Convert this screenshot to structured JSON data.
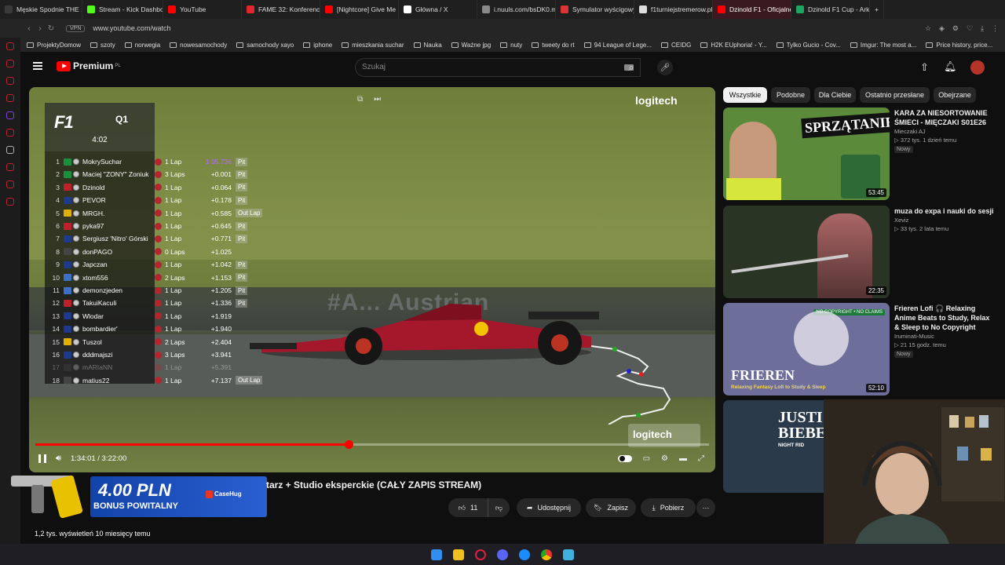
{
  "browser": {
    "tabs": [
      {
        "label": "Męskie Spodnie THE ...",
        "color": "#3a3a3a"
      },
      {
        "label": "Stream - Kick Dashbo...",
        "color": "#53fc18"
      },
      {
        "label": "YouTube",
        "color": "#ff0000"
      },
      {
        "label": "FAME 32: Konferencja...",
        "color": "#e0262b"
      },
      {
        "label": "[Nightcore] Give Me ...",
        "color": "#ff0000"
      },
      {
        "label": "Główna / X",
        "color": "#ffffff"
      },
      {
        "label": "i.nuuls.com/bsDK0.m...",
        "color": "#888888"
      },
      {
        "label": "Symulator wyścigowy ...",
        "color": "#d33"
      },
      {
        "label": "f1turniejstremerow.pl",
        "color": "#ddd"
      },
      {
        "label": "Dzinold F1 - Oficjalne ...",
        "color": "#ff0000"
      },
      {
        "label": "Dzinold F1 Cup - Arku...",
        "color": "#1fa463"
      }
    ],
    "vpn_label": "VPN",
    "url": "www.youtube.com/watch",
    "bookmarks": [
      "ProjektyDomow",
      "szoty",
      "norwegia",
      "nowesamochody",
      "samochody xayo",
      "iphone",
      "mieszkania suchar",
      "Nauka",
      "Ważne jpg",
      "nuty",
      "tweety do rt",
      "94 League of Lege...",
      "CEIDG",
      "H2K EUphoria! - Y...",
      "Tylko Gucio - Cov...",
      "Imgur: The most a...",
      "Price history, price..."
    ]
  },
  "header": {
    "logo_text": "Premium",
    "logo_region": "PL",
    "search_placeholder": "Szukaj"
  },
  "player": {
    "logitech_label": "logitech",
    "session": "Q1",
    "session_timer": "4:02",
    "time_current": "1:34:01",
    "time_total": "3:22:00",
    "time_display": "1:34:01 / 3:22:00",
    "progress_fraction": 0.465,
    "barrier_text": "#A...        Austrian",
    "leaderboard": [
      {
        "pos": "1",
        "name": "MokrySuchar",
        "laps": "1 Lap",
        "gap": "1:05.736",
        "status": "Pit",
        "team": "#1a8f3c",
        "gap_color": "#b36bff"
      },
      {
        "pos": "2",
        "name": "Maciej \"ZONY\" Zoniuk",
        "laps": "3 Laps",
        "gap": "+0.001",
        "status": "Pit",
        "team": "#1a8f3c"
      },
      {
        "pos": "3",
        "name": "Dzinold",
        "laps": "1 Lap",
        "gap": "+0.064",
        "status": "Pit",
        "team": "#c0202a"
      },
      {
        "pos": "4",
        "name": "PEVOR",
        "laps": "1 Lap",
        "gap": "+0.178",
        "status": "Pit",
        "team": "#1e3a8a"
      },
      {
        "pos": "5",
        "name": "MRGH.",
        "laps": "1 Lap",
        "gap": "+0.585",
        "status": "Out Lap",
        "team": "#e0b000"
      },
      {
        "pos": "6",
        "name": "pyka97",
        "laps": "1 Lap",
        "gap": "+0.645",
        "status": "Pit",
        "team": "#c0202a"
      },
      {
        "pos": "7",
        "name": "Sergiusz 'Nitro' Górski",
        "laps": "1 Lap",
        "gap": "+0.771",
        "status": "Pit",
        "team": "#1e3a8a"
      },
      {
        "pos": "8",
        "name": "donPAGO",
        "laps": "0 Laps",
        "gap": "+1.025",
        "status": "",
        "team": "#444444"
      },
      {
        "pos": "9",
        "name": "Japczan",
        "laps": "1 Lap",
        "gap": "+1.042",
        "status": "Pit",
        "team": "#1e3a8a"
      },
      {
        "pos": "10",
        "name": "xtom556",
        "laps": "2 Laps",
        "gap": "+1.153",
        "status": "Pit",
        "team": "#3d6fc7"
      },
      {
        "pos": "11",
        "name": "demonzjeden",
        "laps": "1 Lap",
        "gap": "+1.205",
        "status": "Pit",
        "team": "#3d6fc7"
      },
      {
        "pos": "12",
        "name": "TakuiKacuIi",
        "laps": "1 Lap",
        "gap": "+1.336",
        "status": "Pit",
        "team": "#c0202a"
      },
      {
        "pos": "13",
        "name": "Wlodar",
        "laps": "1 Lap",
        "gap": "+1.919",
        "status": "",
        "team": "#1e3a8a"
      },
      {
        "pos": "14",
        "name": "bombardier'",
        "laps": "1 Lap",
        "gap": "+1.940",
        "status": "",
        "team": "#1e3a8a"
      },
      {
        "pos": "15",
        "name": "Tuszol",
        "laps": "2 Laps",
        "gap": "+2.404",
        "status": "",
        "team": "#e0b000"
      },
      {
        "pos": "16",
        "name": "dddmajszi",
        "laps": "3 Laps",
        "gap": "+3.941",
        "status": "",
        "team": "#1e3a8a"
      },
      {
        "pos": "17",
        "name": "mARIaNN",
        "laps": "1 Lap",
        "gap": "+5.391",
        "status": "",
        "team": "#444444",
        "dim": true
      },
      {
        "pos": "18",
        "name": "matius22",
        "laps": "1 Lap",
        "gap": "+7.137",
        "status": "Out Lap",
        "team": "#444444"
      }
    ]
  },
  "ad": {
    "amount": "4.00 PLN",
    "bonus": "BONUS POWITALNY",
    "brand": "CaseHug"
  },
  "video": {
    "title": "tarz + Studio eksperckie (CAŁY ZAPIS STREAM)",
    "likes": "11",
    "share_label": "Udostępnij",
    "save_label": "Zapisz",
    "download_label": "Pobierz",
    "stats": "1,2 tys. wyświetleń  10 miesięcy temu"
  },
  "chips": [
    "Wszystkie",
    "Podobne",
    "Dla Ciebie",
    "Ostatnio przesłane",
    "Obejrzane"
  ],
  "recommendations": [
    {
      "title": "KARA ZA NIESORTOWANIE ŚMIECI - MIĘCZAKI S01E26",
      "channel": "Mieczaki AJ",
      "meta": "▷ 372 tys.  1 dzień temu",
      "badge": "Nowy",
      "duration": "53:45",
      "thumb_text": "SPRZĄTANIE",
      "thumb_color": "#5b8a3a"
    },
    {
      "title": "muza do expa i nauki do sesji",
      "channel": "Xeviz",
      "meta": "▷ 33 tys.  2 lata temu",
      "badge": "",
      "duration": "22:35",
      "thumb_text": "",
      "thumb_color": "#2a3424"
    },
    {
      "title": "Frieren Lofi 🎧 Relaxing Anime Beats to Study, Relax & Sleep to No Copyright",
      "channel": "Iruminati-Music",
      "meta": "▷ 21  15 godz. temu",
      "badge": "Nowy",
      "duration": "52:10",
      "thumb_text": "FRIEREN",
      "thumb_sub": "Relaxing Fantasy Lofi to Study & Sleep",
      "thumb_color": "#6d6f9a",
      "thumb_tag": "NO COPYRIGHT • NO CLAIMS"
    },
    {
      "title": "",
      "channel": "",
      "meta": "",
      "badge": "",
      "duration": "",
      "thumb_text": "JUSTI BIEBE",
      "thumb_sub": "NIGHT RID",
      "thumb_color": "#2b3a4a"
    }
  ]
}
